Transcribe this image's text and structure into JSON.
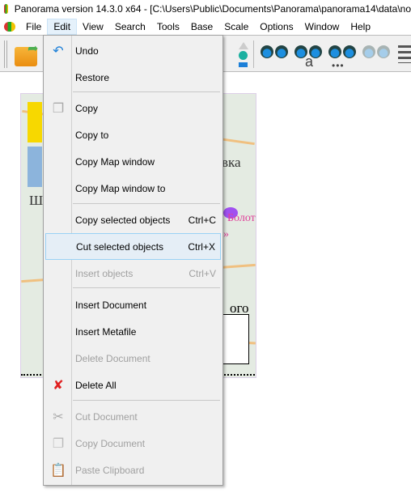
{
  "window": {
    "title": "Panorama version 14.3.0 x64 - [C:\\Users\\Public\\Documents\\Panorama\\panorama14\\data\\no"
  },
  "menubar": [
    {
      "label": "File"
    },
    {
      "label": "Edit"
    },
    {
      "label": "View"
    },
    {
      "label": "Search"
    },
    {
      "label": "Tools"
    },
    {
      "label": "Base"
    },
    {
      "label": "Scale"
    },
    {
      "label": "Options"
    },
    {
      "label": "Window"
    },
    {
      "label": "Help"
    }
  ],
  "map_labels": {
    "a": "вка",
    "b": "Болото",
    "c": "»",
    "d": "Ш",
    "e": "ого"
  },
  "edit_menu": {
    "items": [
      {
        "label": "Undo",
        "icon": "undo-icon"
      },
      {
        "label": "Restore"
      },
      {
        "label": "Copy",
        "icon": "copy-icon"
      },
      {
        "label": "Copy to"
      },
      {
        "label": "Copy Map window"
      },
      {
        "label": "Copy Map window to"
      },
      {
        "label": "Copy selected objects",
        "shortcut": "Ctrl+C"
      },
      {
        "label": "Cut selected objects",
        "shortcut": "Ctrl+X",
        "highlighted": true
      },
      {
        "label": "Insert objects",
        "shortcut": "Ctrl+V",
        "disabled": true
      },
      {
        "label": "Insert Document"
      },
      {
        "label": "Insert Metafile"
      },
      {
        "label": "Delete Document",
        "disabled": true
      },
      {
        "label": "Delete All",
        "icon": "delete-x-icon"
      },
      {
        "label": "Cut Document",
        "icon": "scissors-icon",
        "disabled": true
      },
      {
        "label": "Copy Document",
        "icon": "copy-document-icon",
        "disabled": true
      },
      {
        "label": "Paste Clipboard",
        "icon": "clipboard-icon",
        "disabled": true
      }
    ]
  }
}
